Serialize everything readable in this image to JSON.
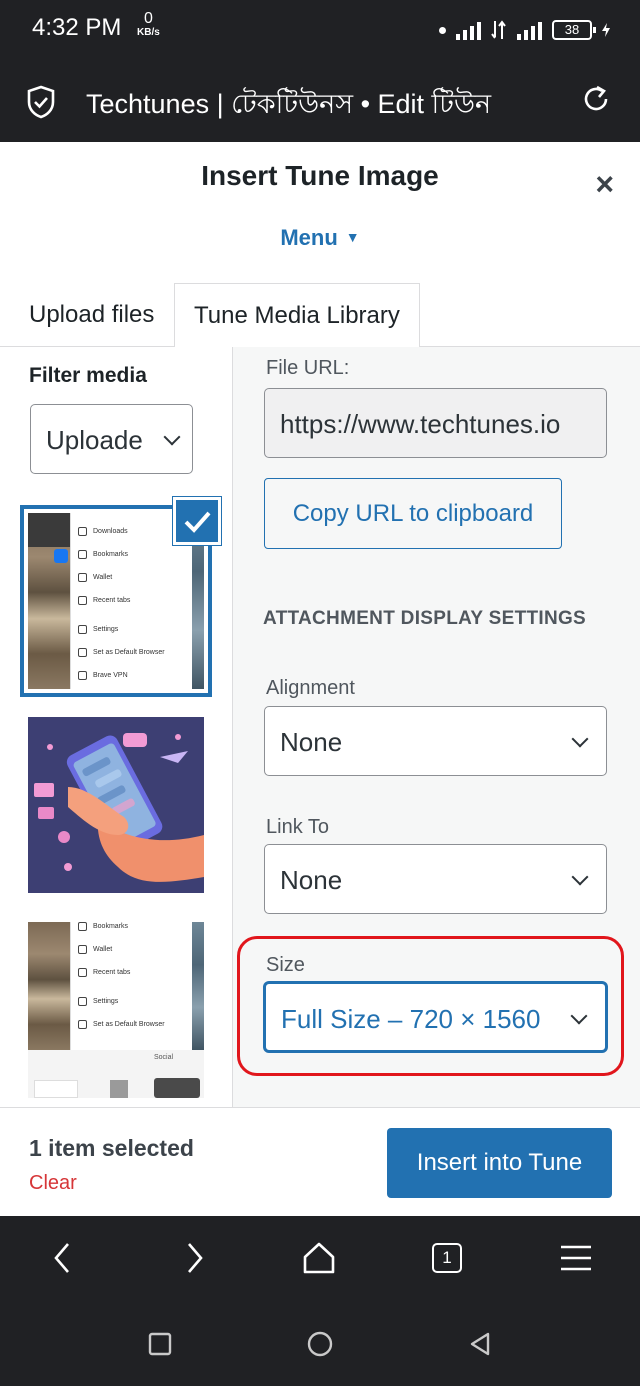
{
  "status_bar": {
    "time": "4:32 PM",
    "net_speed": "0",
    "net_unit": "KB/s",
    "battery": "38"
  },
  "browser": {
    "title": "Techtunes | টেকটিউনস • Edit টিউন",
    "icons": [
      "shield-icon",
      "reload-icon"
    ]
  },
  "modal": {
    "title": "Insert Tune Image",
    "close": "×",
    "menu_label": "Menu"
  },
  "tabs": [
    {
      "label": "Upload files",
      "active": false
    },
    {
      "label": "Tune Media Library",
      "active": true
    }
  ],
  "filter": {
    "label": "Filter media",
    "value": "Uploade"
  },
  "thumbnails": {
    "menu_items": [
      "Downloads",
      "Bookmarks",
      "Wallet",
      "Recent tabs",
      "Settings",
      "Set as Default Browser",
      "Brave VPN"
    ],
    "menu_items_3": [
      "Bookmarks",
      "Wallet",
      "Recent tabs",
      "Settings",
      "Set as Default Browser"
    ],
    "social": "Social"
  },
  "details": {
    "file_url_label": "File URL:",
    "file_url_value": "https://www.techtunes.io",
    "copy_button": "Copy URL to clipboard",
    "section_heading": "ATTACHMENT DISPLAY SETTINGS",
    "alignment_label": "Alignment",
    "alignment_value": "None",
    "link_to_label": "Link To",
    "link_to_value": "None",
    "size_label": "Size",
    "size_value": "Full Size – 720 × 1560"
  },
  "footer": {
    "selected_text": "1 item selected",
    "clear_label": "Clear",
    "insert_button": "Insert into Tune"
  },
  "browser_nav": {
    "tab_count": "1"
  },
  "colors": {
    "accent": "#2271b1",
    "danger": "#d63638",
    "highlight": "#e1161c",
    "chrome": "#202124"
  }
}
